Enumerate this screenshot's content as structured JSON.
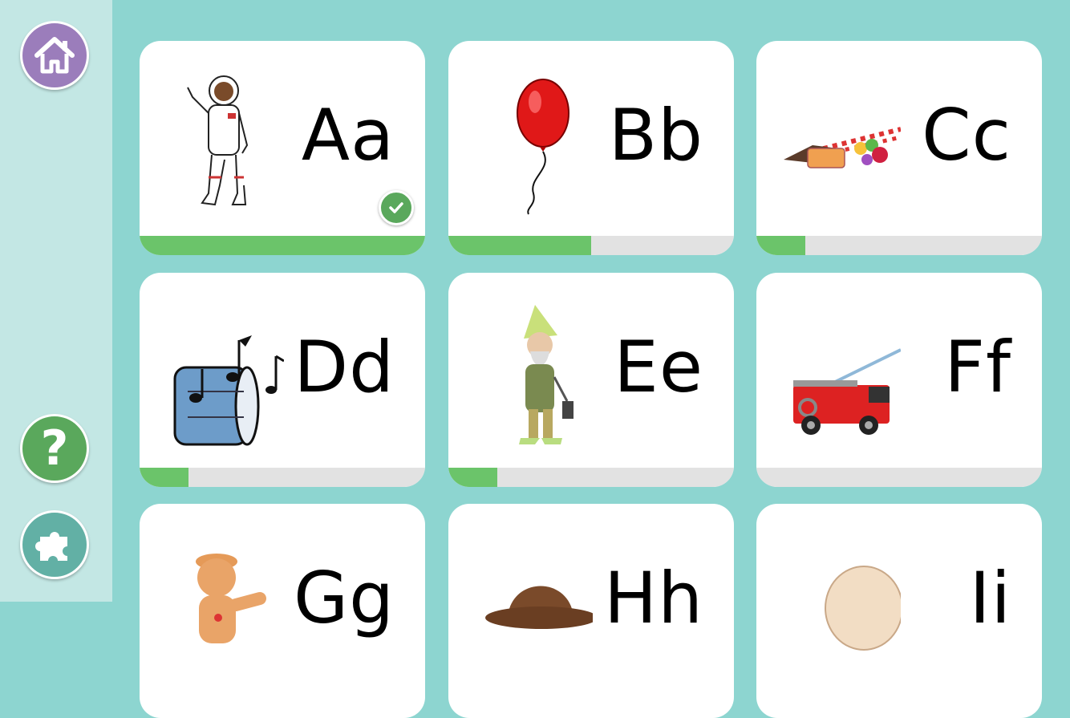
{
  "sidebar": {
    "home_icon": "home-icon",
    "help_label": "?",
    "puzzle_icon": "puzzle-icon"
  },
  "colors": {
    "background": "#8dd5d0",
    "sidebar": "#c3e7e4",
    "home_button": "#9b7dbb",
    "help_button": "#5aa85c",
    "puzzle_button": "#62b0a5",
    "progress_fill": "#6bc46a",
    "progress_track": "#e2e2e2"
  },
  "cards": [
    {
      "letters": "Aa",
      "image": "astronaut-image",
      "progress": 1.0,
      "completed": true
    },
    {
      "letters": "Bb",
      "image": "balloon-image",
      "progress": 0.5,
      "completed": false
    },
    {
      "letters": "Cc",
      "image": "candy-image",
      "progress": 0.17,
      "completed": false
    },
    {
      "letters": "Dd",
      "image": "drum-image",
      "progress": 0.17,
      "completed": false
    },
    {
      "letters": "Ee",
      "image": "elf-image",
      "progress": 0.17,
      "completed": false
    },
    {
      "letters": "Ff",
      "image": "firetruck-image",
      "progress": 0.0,
      "completed": false
    },
    {
      "letters": "Gg",
      "image": "gingerbread-image",
      "progress": null,
      "completed": false
    },
    {
      "letters": "Hh",
      "image": "hat-image",
      "progress": null,
      "completed": false
    },
    {
      "letters": "Ii",
      "image": "infant-image",
      "progress": null,
      "completed": false
    }
  ]
}
